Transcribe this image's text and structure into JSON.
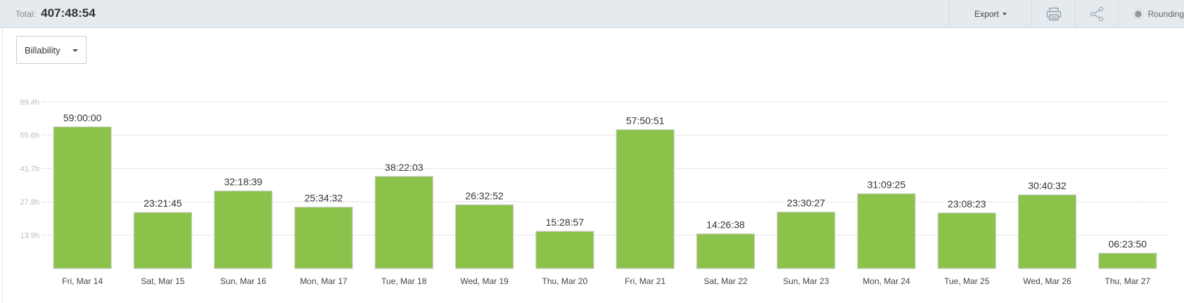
{
  "header": {
    "total_label": "Total:",
    "total_value": "407:48:54",
    "export_label": "Export",
    "rounding_label": "Rounding",
    "rounding_on": false
  },
  "filter": {
    "selected": "Billability"
  },
  "colors": {
    "bar": "#8bc34a",
    "topbar": "#e4eaee"
  },
  "icons": {
    "print": "printer-icon",
    "share": "share-icon"
  },
  "chart_data": {
    "type": "bar",
    "categories": [
      "Fri, Mar 14",
      "Sat, Mar 15",
      "Sun, Mar 16",
      "Mon, Mar 17",
      "Tue, Mar 18",
      "Wed, Mar 19",
      "Thu, Mar 20",
      "Fri, Mar 21",
      "Sat, Mar 22",
      "Sun, Mar 23",
      "Mon, Mar 24",
      "Tue, Mar 25",
      "Wed, Mar 26",
      "Thu, Mar 27"
    ],
    "value_labels": [
      "59:00:00",
      "23:21:45",
      "32:18:39",
      "25:34:32",
      "38:22:03",
      "26:32:52",
      "15:28:57",
      "57:50:51",
      "14:26:38",
      "23:30:27",
      "31:09:25",
      "23:08:23",
      "30:40:32",
      "06:23:50"
    ],
    "values": [
      59.0,
      23.3625,
      32.3108,
      25.5756,
      38.3675,
      26.5478,
      15.4825,
      57.8475,
      14.4439,
      23.5075,
      31.1569,
      23.1397,
      30.6756,
      6.3972
    ],
    "yticks": [
      "13.9h",
      "27.8h",
      "41.7h",
      "55.6h",
      "69.4h"
    ],
    "ytick_values": [
      13.9,
      27.8,
      41.7,
      55.6,
      69.4
    ],
    "ylim": [
      0,
      69.4
    ],
    "grid": true,
    "title": "",
    "xlabel": "",
    "ylabel": ""
  }
}
